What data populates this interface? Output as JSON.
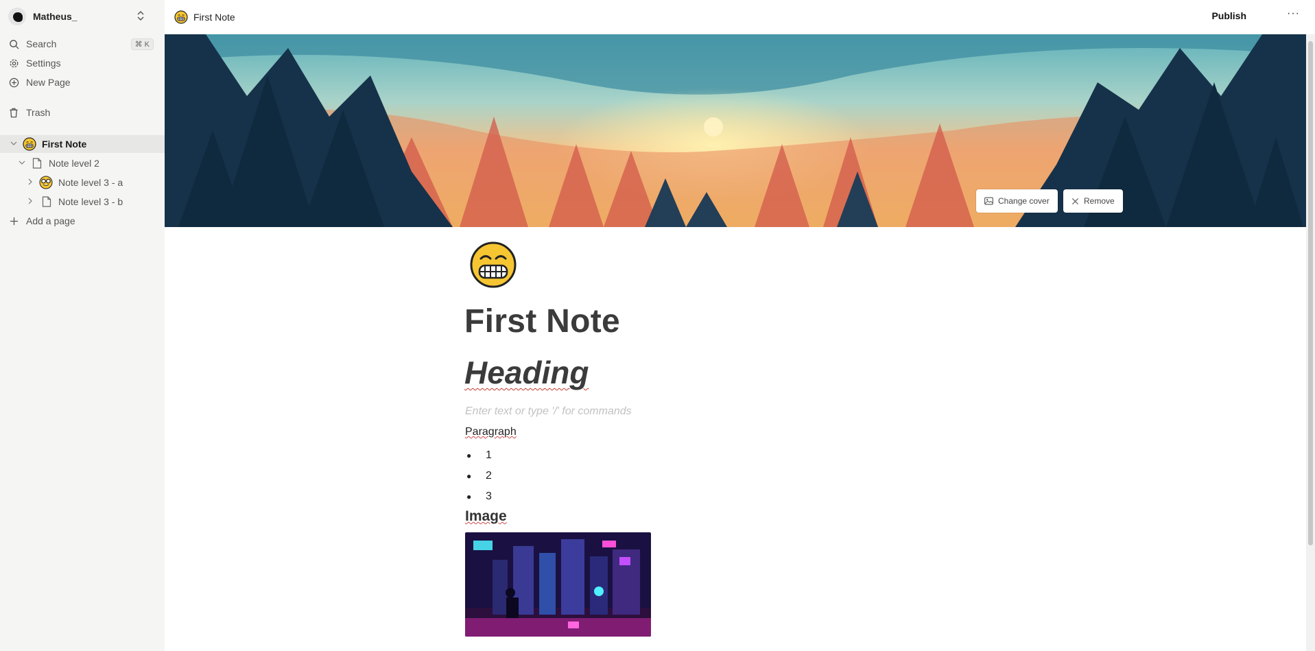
{
  "sidebar": {
    "user_name": "Matheus_",
    "search_label": "Search",
    "search_shortcut": "⌘ K",
    "settings_label": "Settings",
    "new_page_label": "New Page",
    "trash_label": "Trash",
    "tree": [
      {
        "label": "First Note",
        "icon": "grinning-emoji",
        "expanded": true,
        "active": true
      },
      {
        "label": "Note level 2",
        "icon": "document-icon",
        "expanded": true
      },
      {
        "label": "Note level 3 - a",
        "icon": "nerd-face-emoji",
        "expanded": false
      },
      {
        "label": "Note level 3 - b",
        "icon": "document-icon",
        "expanded": false
      }
    ],
    "add_page_label": "Add a page"
  },
  "topbar": {
    "title": "First Note",
    "publish_label": "Publish",
    "more_label": "···"
  },
  "cover": {
    "change_label": "Change cover",
    "remove_label": "Remove"
  },
  "document": {
    "title": "First Note",
    "heading": "Heading",
    "placeholder": "Enter text or type '/' for commands",
    "paragraph": "Paragraph",
    "list": [
      "1",
      "2",
      "3"
    ],
    "image_heading": "Image"
  }
}
